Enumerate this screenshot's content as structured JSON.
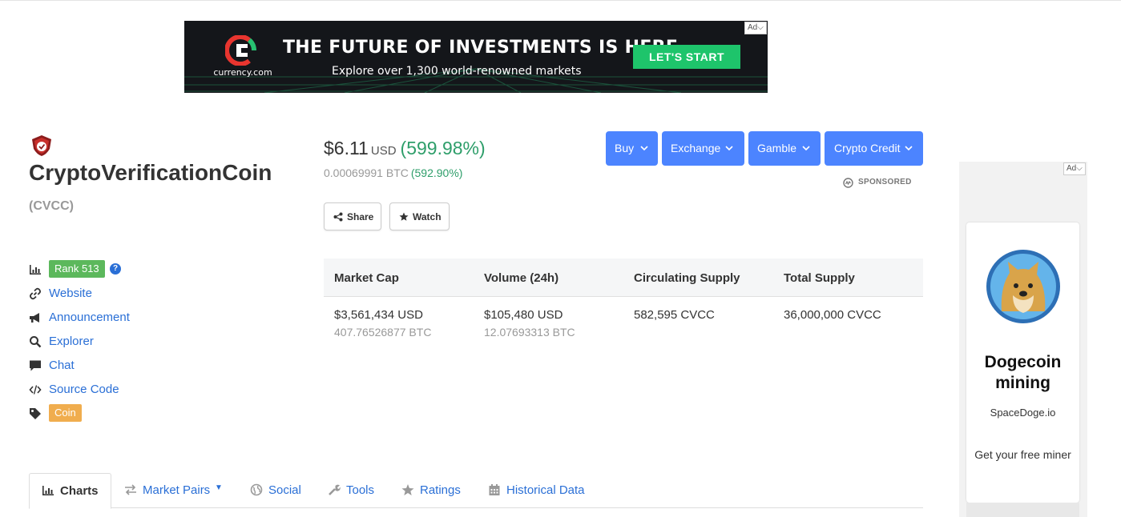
{
  "banner": {
    "logo_text": "currency.com",
    "headline": "THE FUTURE OF INVESTMENTS IS HERE",
    "subline": "Explore over 1,300 world-renowned markets",
    "cta": "LET'S START",
    "ad_label": "Ad"
  },
  "coin": {
    "name": "CryptoVerificationCoin",
    "symbol": "(CVCC)"
  },
  "links": {
    "rank": "Rank 513",
    "help": "?",
    "website": "Website",
    "announcement": "Announcement",
    "explorer": "Explorer",
    "chat": "Chat",
    "source_code": "Source Code",
    "tag": "Coin"
  },
  "price": {
    "value": "$6.11",
    "currency": "USD",
    "change": "(599.98%)",
    "btc_value": "0.00069991 BTC",
    "btc_change": "(592.90%)"
  },
  "actions": {
    "share": "Share",
    "watch": "Watch"
  },
  "menu_buttons": {
    "buy": "Buy",
    "exchange": "Exchange",
    "gamble": "Gamble",
    "crypto_credit": "Crypto Credit",
    "sponsored": "SPONSORED"
  },
  "stats": {
    "headers": [
      "Market Cap",
      "Volume (24h)",
      "Circulating Supply",
      "Total Supply"
    ],
    "values": [
      "$3,561,434 USD",
      "$105,480 USD",
      "582,595 CVCC",
      "36,000,000 CVCC"
    ],
    "subvalues": [
      "407.76526877 BTC",
      "12.07693313 BTC",
      "",
      ""
    ]
  },
  "tabs": {
    "charts": "Charts",
    "market_pairs": "Market Pairs",
    "social": "Social",
    "tools": "Tools",
    "ratings": "Ratings",
    "historical": "Historical Data"
  },
  "side_ad": {
    "ad_label": "Ad",
    "title": "Dogecoin mining",
    "host": "SpaceDoge.io",
    "cta": "Get your free miner"
  },
  "colors": {
    "accent_blue": "#4c84ff",
    "link_blue": "#2a6fd6",
    "positive_green": "#2e9e6a",
    "rank_green": "#5cb85c",
    "coin_orange": "#f0ad4e",
    "banner_cta_green": "#1ec46b"
  }
}
